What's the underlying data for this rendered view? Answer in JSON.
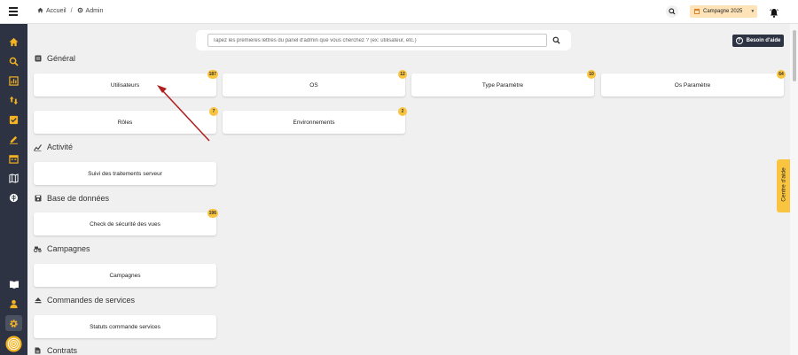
{
  "topbar": {
    "breadcrumb": [
      {
        "icon": "home-icon",
        "label": "Accueil"
      },
      {
        "icon": "gear-icon",
        "label": "Admin"
      }
    ],
    "breadcrumb_separator": "/",
    "campaign_label": "Campagne 2025"
  },
  "search": {
    "placeholder": "Tapez les premières lettres du panel d'admin que vous cherchez ? (ex: utilisateur, etc.)"
  },
  "help_button": "Besoin d'aide",
  "help_center": "Centre d'aide",
  "sidebar": {
    "items": [
      {
        "icon": "home-icon"
      },
      {
        "icon": "search-icon"
      },
      {
        "icon": "chart-icon"
      },
      {
        "icon": "sort-arrows-icon"
      },
      {
        "icon": "checklist-icon"
      },
      {
        "icon": "pen-icon"
      },
      {
        "icon": "calendar-icon"
      },
      {
        "icon": "map-icon"
      },
      {
        "icon": "leaf-icon"
      },
      {
        "icon": "book-icon"
      },
      {
        "icon": "user-icon"
      },
      {
        "icon": "gear-icon"
      },
      {
        "icon": "fingerprint-icon"
      }
    ]
  },
  "sections": {
    "general": {
      "title": "Général",
      "cards": [
        {
          "label": "Utilisateurs",
          "badge": "187"
        },
        {
          "label": "OS",
          "badge": "12"
        },
        {
          "label": "Type Paramètre",
          "badge": "10"
        },
        {
          "label": "Os Paramètre",
          "badge": "64"
        },
        {
          "label": "Rôles",
          "badge": "7"
        },
        {
          "label": "Environnements",
          "badge": "2"
        }
      ]
    },
    "activite": {
      "title": "Activité",
      "cards": [
        {
          "label": "Suivi des traitements serveur"
        }
      ]
    },
    "database": {
      "title": "Base de données",
      "cards": [
        {
          "label": "Check de sécurité des vues",
          "badge": "196"
        }
      ]
    },
    "campagnes": {
      "title": "Campagnes",
      "cards": [
        {
          "label": "Campagnes"
        }
      ]
    },
    "commandes": {
      "title": "Commandes de services",
      "cards": [
        {
          "label": "Statuts commande services"
        }
      ]
    },
    "contrats": {
      "title": "Contrats"
    }
  },
  "colors": {
    "sidebar": "#2d3342",
    "badge": "#f9c440",
    "annotation_arrow": "#b01d1d",
    "campaign_bg": "#fde3b7"
  }
}
